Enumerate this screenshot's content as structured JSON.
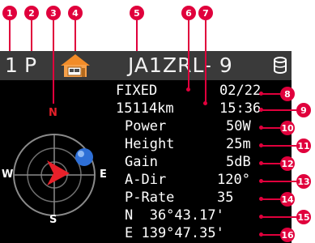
{
  "callouts": [
    "1",
    "2",
    "3",
    "4",
    "5",
    "6",
    "7",
    "8",
    "9",
    "10",
    "11",
    "12",
    "13",
    "14",
    "15",
    "16"
  ],
  "status_bar": {
    "channel": "1",
    "mode": "P",
    "icon": "home-station-icon",
    "callsign": "JA1ZRL- 9",
    "bank_icon": "memory-bank-icon"
  },
  "compass": {
    "north": "N",
    "east": "E",
    "south": "S",
    "west": "W",
    "heading_arrow": "red-arrow"
  },
  "info": {
    "fixed": "FIXED",
    "date": "02/22",
    "distance": "15114km",
    "time": "15:36",
    "power_label": "Power",
    "power_value": "50W",
    "height_label": "Height",
    "height_value": "25m",
    "gain_label": "Gain",
    "gain_value": "5dB",
    "adir_label": "A-Dir",
    "adir_value": "120°",
    "prate_label": "P-Rate",
    "prate_value": "35",
    "lat": "N  36°43.17'",
    "lon": "E 139°47.35'"
  },
  "colors": {
    "callout": "#e0003c",
    "screen": "#000000",
    "status_bar": "#3a3a3a",
    "station_dot": "#2e6fd6",
    "arrow": "#e8202a"
  }
}
